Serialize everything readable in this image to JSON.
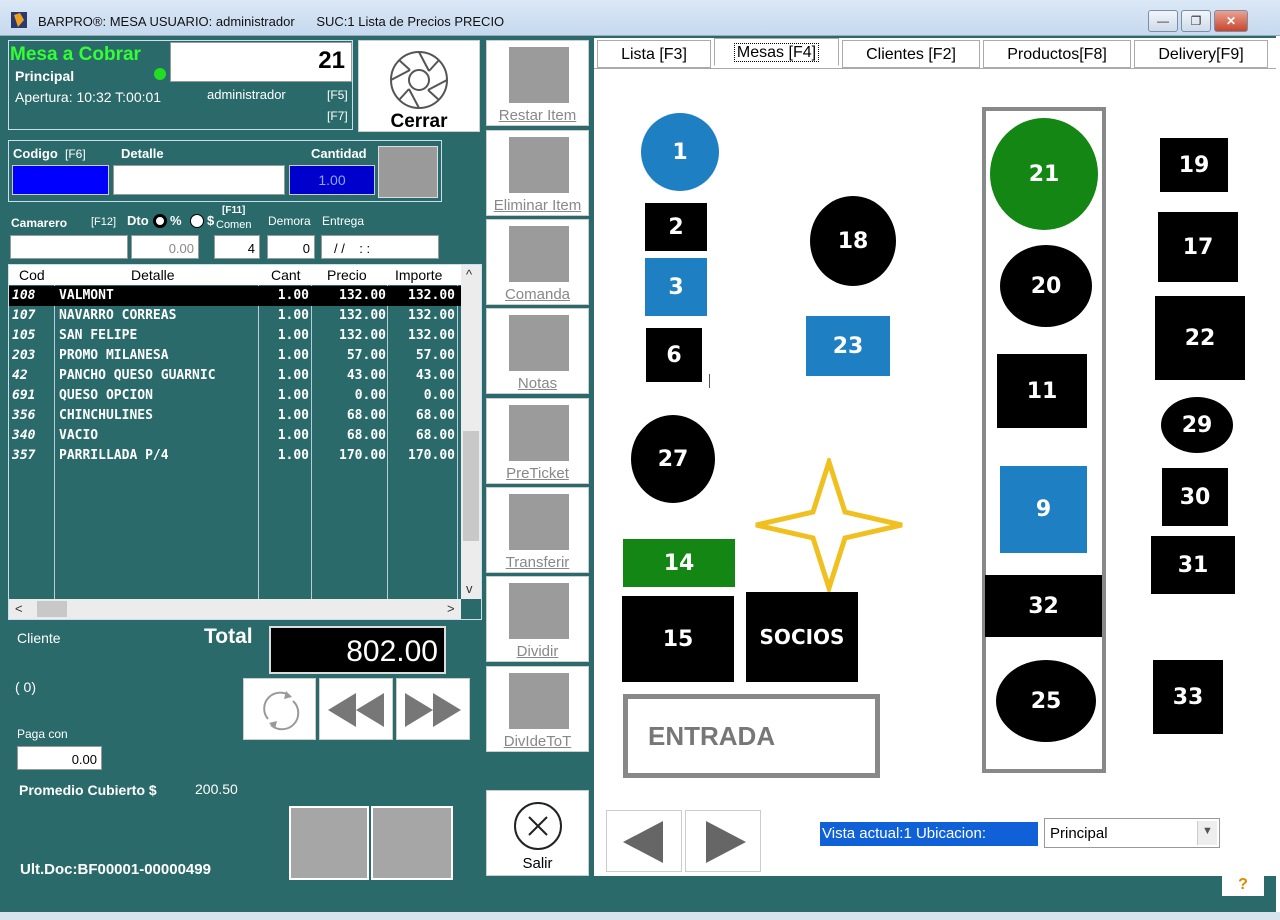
{
  "window": {
    "title": "BARPRO®: MESA USUARIO: administrador      SUC:1 Lista de Precios PRECIO",
    "minimize": "—",
    "restore": "❐",
    "close": "✕"
  },
  "mesa": {
    "title": "Mesa a Cobrar",
    "number": "21",
    "location": "Principal",
    "apertura": "Apertura: 10:32 T:00:01",
    "user": "administrador",
    "f5": "[F5]",
    "f7": "[F7]",
    "cerrar": "Cerrar"
  },
  "entry": {
    "codigo_label": "Codigo",
    "codigo_key": "[F6]",
    "detalle_label": "Detalle",
    "cantidad_label": "Cantidad",
    "cantidad_value": "1.00"
  },
  "camarero": {
    "label": "Camarero",
    "key": "[F12]",
    "dto_label": "Dto",
    "pct_label": "%",
    "usd_label": "$",
    "comen_key": "[F11]",
    "comen_label": "Comen",
    "demora_label": "Demora",
    "entrega_label": "Entrega",
    "dto_value": "0.00",
    "comen_value": "4",
    "demora_value": "0",
    "entrega_value": "/ /    : :"
  },
  "grid": {
    "headers": [
      "Cod",
      "Detalle",
      "Cant",
      "Precio",
      "Importe"
    ],
    "rows": [
      {
        "cod": "108",
        "detalle": "VALMONT",
        "cant": "1.00",
        "precio": "132.00",
        "importe": "132.00"
      },
      {
        "cod": "107",
        "detalle": "NAVARRO CORREAS",
        "cant": "1.00",
        "precio": "132.00",
        "importe": "132.00"
      },
      {
        "cod": "105",
        "detalle": "SAN FELIPE",
        "cant": "1.00",
        "precio": "132.00",
        "importe": "132.00"
      },
      {
        "cod": "203",
        "detalle": "PROMO MILANESA",
        "cant": "1.00",
        "precio": "57.00",
        "importe": "57.00"
      },
      {
        "cod": "42",
        "detalle": "PANCHO QUESO GUARNIC",
        "cant": "1.00",
        "precio": "43.00",
        "importe": "43.00"
      },
      {
        "cod": "691",
        "detalle": "QUESO OPCION",
        "cant": "1.00",
        "precio": "0.00",
        "importe": "0.00"
      },
      {
        "cod": "356",
        "detalle": "CHINCHULINES",
        "cant": "1.00",
        "precio": "68.00",
        "importe": "68.00"
      },
      {
        "cod": "340",
        "detalle": "VACIO",
        "cant": "1.00",
        "precio": "68.00",
        "importe": "68.00"
      },
      {
        "cod": "357",
        "detalle": "PARRILLADA P/4",
        "cant": "1.00",
        "precio": "170.00",
        "importe": "170.00"
      }
    ]
  },
  "footer": {
    "cliente_label": "Cliente",
    "total_label": "Total",
    "total_value": "802.00",
    "cliente_count": "( 0)",
    "paga_label": "Paga con",
    "paga_value": "0.00",
    "promedio_label": "Promedio Cubierto $",
    "promedio_value": "200.50",
    "ult_doc": "Ult.Doc:BF00001-00000499"
  },
  "actions": [
    {
      "label": "Restar Item"
    },
    {
      "label": "Eliminar Item"
    },
    {
      "label": "Comanda"
    },
    {
      "label": "Notas"
    },
    {
      "label": "PreTicket"
    },
    {
      "label": "Transferir"
    },
    {
      "label": "Dividir"
    },
    {
      "label": "DivIdeToT"
    }
  ],
  "salir": "Salir",
  "tabs": [
    {
      "label": "Lista  [F3]"
    },
    {
      "label": "Mesas [F4]"
    },
    {
      "label": "Clientes [F2]"
    },
    {
      "label": "Productos[F8]"
    },
    {
      "label": "Delivery[F9]"
    }
  ],
  "tables": [
    "1",
    "2",
    "3",
    "6",
    "18",
    "23",
    "27",
    "14",
    "15",
    "SOCIOS",
    "21",
    "20",
    "11",
    "9",
    "32",
    "25",
    "19",
    "17",
    "22",
    "29",
    "30",
    "31",
    "33"
  ],
  "entrada": "ENTRADA",
  "vista": "Vista actual:1  Ubicacion:",
  "ubicacion": "Principal",
  "help": "?",
  "colors": {
    "background": "#2b6a6a",
    "green": "#138613",
    "blue": "#1e7fc2",
    "bright_green": "#33ff33",
    "highlight": "#1060d8"
  }
}
